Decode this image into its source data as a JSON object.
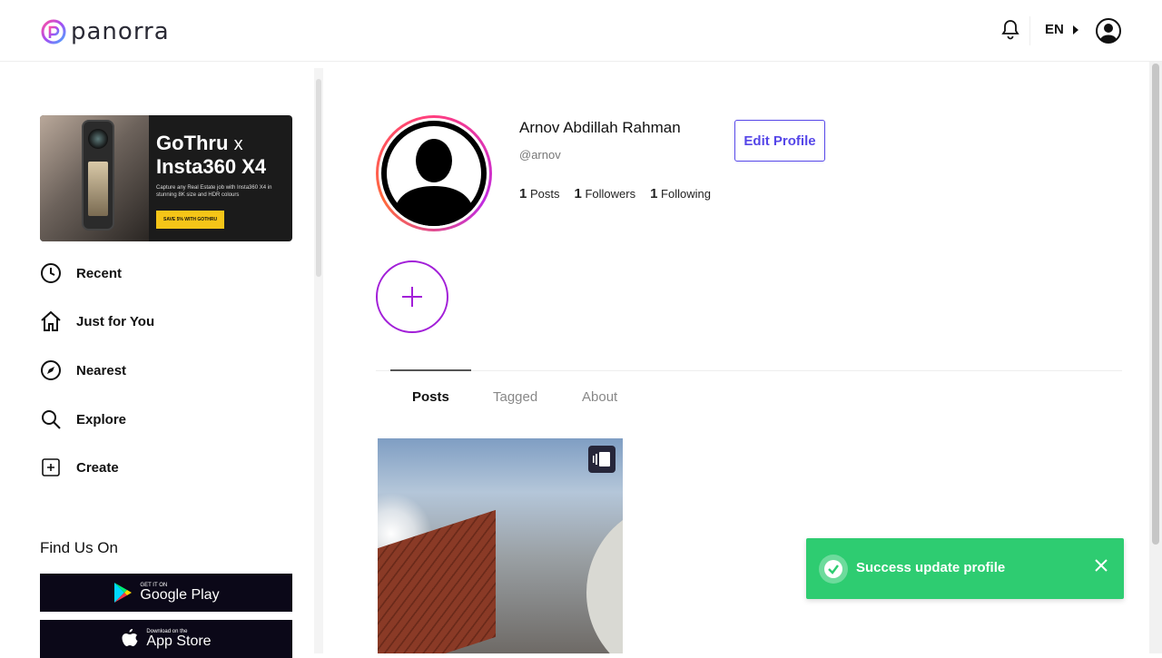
{
  "app": {
    "name": "panorra"
  },
  "header": {
    "language": "EN"
  },
  "banner": {
    "title_brand": "GoThru",
    "title_x": "x",
    "title_product": "Insta360 X4",
    "subtitle": "Capture any Real Estate job with Insta360 X4 in stunning 8K size and HDR colours",
    "cta": "SAVE 5% WITH GOTHRU"
  },
  "sidebar": {
    "items": [
      {
        "label": "Recent",
        "icon": "clock-icon"
      },
      {
        "label": "Just for You",
        "icon": "home-icon"
      },
      {
        "label": "Nearest",
        "icon": "navigation-icon"
      },
      {
        "label": "Explore",
        "icon": "search-icon"
      },
      {
        "label": "Create",
        "icon": "plus-square-icon"
      }
    ],
    "find_us": "Find Us On",
    "google_play": {
      "small": "GET IT ON",
      "big": "Google Play"
    },
    "app_store": {
      "small": "Download on the",
      "big": "App Store"
    }
  },
  "profile": {
    "name": "Arnov Abdillah Rahman",
    "handle": "@arnov",
    "edit_label": "Edit Profile",
    "stats": [
      {
        "count": "1",
        "label": "Posts"
      },
      {
        "count": "1",
        "label": "Followers"
      },
      {
        "count": "1",
        "label": "Following"
      }
    ]
  },
  "tabs": [
    {
      "label": "Posts",
      "active": true
    },
    {
      "label": "Tagged",
      "active": false
    },
    {
      "label": "About",
      "active": false
    }
  ],
  "toast": {
    "message": "Success update profile",
    "color": "#2ecc71"
  },
  "colors": {
    "accent": "#5546e8",
    "story_ring": "#a21fd8"
  }
}
